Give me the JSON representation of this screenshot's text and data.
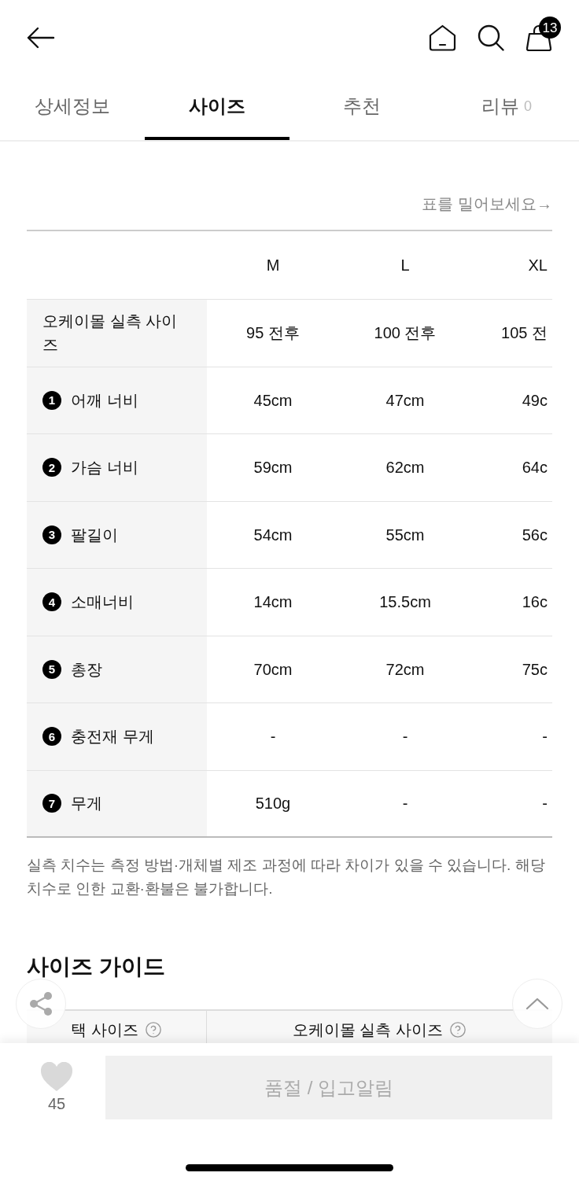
{
  "top_bar": {
    "cart_count": "13"
  },
  "tabs": [
    {
      "label": "상세정보",
      "selected": false
    },
    {
      "label": "사이즈",
      "selected": true
    },
    {
      "label": "추천",
      "selected": false
    },
    {
      "label": "리뷰",
      "count": "0",
      "selected": false
    }
  ],
  "size_table": {
    "hint": "표를 밀어보세요→",
    "columns": [
      "M",
      "L",
      "XL"
    ],
    "rows": [
      {
        "label": "오케이몰 실측 사이즈",
        "cells": [
          "95 전후",
          "100 전후",
          "105 전"
        ]
      },
      {
        "number": "1",
        "label": "어깨 너비",
        "cells": [
          "45cm",
          "47cm",
          "49c"
        ]
      },
      {
        "number": "2",
        "label": "가슴 너비",
        "cells": [
          "59cm",
          "62cm",
          "64c"
        ]
      },
      {
        "number": "3",
        "label": "팔길이",
        "cells": [
          "54cm",
          "55cm",
          "56c"
        ]
      },
      {
        "number": "4",
        "label": "소매너비",
        "cells": [
          "14cm",
          "15.5cm",
          "16c"
        ]
      },
      {
        "number": "5",
        "label": "총장",
        "cells": [
          "70cm",
          "72cm",
          "75c"
        ]
      },
      {
        "number": "6",
        "label": "충전재 무게",
        "cells": [
          "-",
          "-",
          "-"
        ]
      },
      {
        "number": "7",
        "label": "무게",
        "cells": [
          "510g",
          "-",
          "-"
        ]
      }
    ]
  },
  "note": "실측 치수는 측정 방법·개체별 제조 과정에 따라 차이가 있을 수 있습니다. 해당 치수로 인한 교환·환불은 불가합니다.",
  "size_guide": {
    "title": "사이즈 가이드",
    "columns": [
      "택 사이즈",
      "오케이몰 실측 사이즈"
    ]
  },
  "bottom_bar": {
    "likes": "45",
    "button": "품절 / 입고알림"
  }
}
